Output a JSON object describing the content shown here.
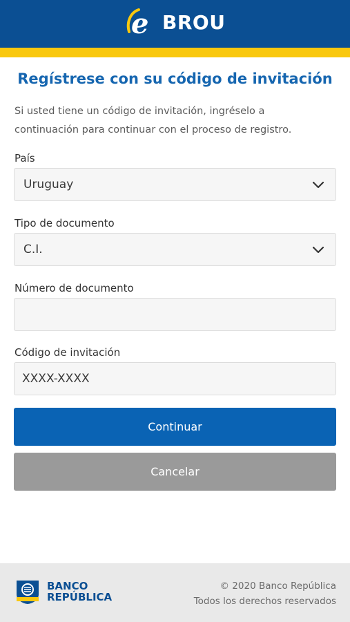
{
  "header": {
    "logo_text": "BROU",
    "logo_mark": "e",
    "colors": {
      "primary": "#0b4f93",
      "accent": "#f9c80e"
    }
  },
  "page": {
    "title": "Regístrese con su código de invitación",
    "intro_line1": "Si usted tiene un código de invitación, ingréselo a",
    "intro_line2": "continuación para continuar con el proceso de registro."
  },
  "form": {
    "country": {
      "label": "País",
      "value": "Uruguay",
      "icon": "chevron-down-icon"
    },
    "document_type": {
      "label": "Tipo de documento",
      "value": "C.I.",
      "icon": "chevron-down-icon"
    },
    "document_number": {
      "label": "Número de documento",
      "value": "",
      "placeholder": ""
    },
    "invitation_code": {
      "label": "Código de invitación",
      "value": "",
      "placeholder": "XXXX-XXXX"
    }
  },
  "actions": {
    "continue_label": "Continuar",
    "cancel_label": "Cancelar",
    "colors": {
      "continue": "#0a63b4",
      "cancel": "#9a9a9a"
    }
  },
  "footer": {
    "brand_line1": "BANCO",
    "brand_line2": "REPÚBLICA",
    "copyright": "© 2020 Banco República",
    "rights": "Todos los derechos reservados"
  }
}
